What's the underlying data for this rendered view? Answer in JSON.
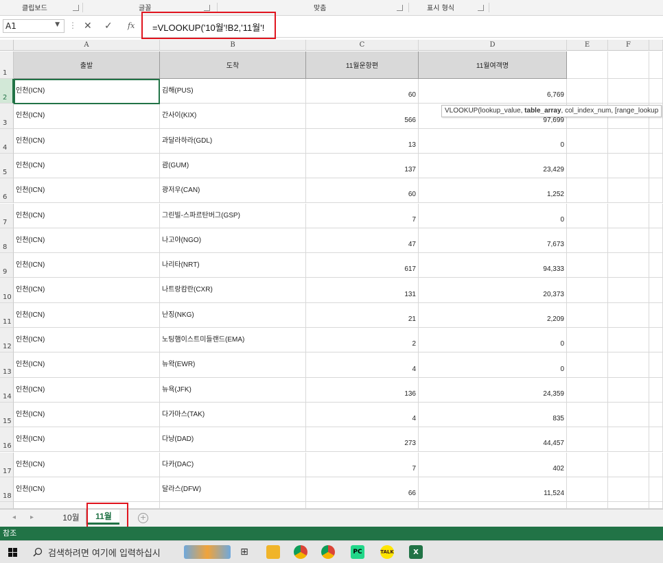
{
  "ribbon": {
    "groups": [
      "클립보드",
      "글꼴",
      "맞춤",
      "표시 형식"
    ]
  },
  "formula_bar": {
    "name_box": "A1",
    "formula": "=VLOOKUP('10월'!B2,'11월'!"
  },
  "tooltip": {
    "prefix": "VLOOKUP(lookup_value, ",
    "bold": "table_array",
    "suffix": ", col_index_num, [range_lookup"
  },
  "columns": [
    "A",
    "B",
    "C",
    "D",
    "E",
    "F"
  ],
  "headers": [
    "출발",
    "도착",
    "11월운항편",
    "11월여객명"
  ],
  "rows": [
    {
      "n": "1"
    },
    {
      "n": "2",
      "a": "인천(ICN)",
      "b": "김해(PUS)",
      "c": "60",
      "d": "6,769"
    },
    {
      "n": "3",
      "a": "인천(ICN)",
      "b": "간사이(KIX)",
      "c": "566",
      "d": "97,699"
    },
    {
      "n": "4",
      "a": "인천(ICN)",
      "b": "과달라하라(GDL)",
      "c": "13",
      "d": "0"
    },
    {
      "n": "5",
      "a": "인천(ICN)",
      "b": "괌(GUM)",
      "c": "137",
      "d": "23,429"
    },
    {
      "n": "6",
      "a": "인천(ICN)",
      "b": "광저우(CAN)",
      "c": "60",
      "d": "1,252"
    },
    {
      "n": "7",
      "a": "인천(ICN)",
      "b": "그린빌-스파르탄버그(GSP)",
      "c": "7",
      "d": "0"
    },
    {
      "n": "8",
      "a": "인천(ICN)",
      "b": "나고야(NGO)",
      "c": "47",
      "d": "7,673"
    },
    {
      "n": "9",
      "a": "인천(ICN)",
      "b": "나리타(NRT)",
      "c": "617",
      "d": "94,333"
    },
    {
      "n": "10",
      "a": "인천(ICN)",
      "b": "나트랑캄란(CXR)",
      "c": "131",
      "d": "20,373"
    },
    {
      "n": "11",
      "a": "인천(ICN)",
      "b": "난징(NKG)",
      "c": "21",
      "d": "2,209"
    },
    {
      "n": "12",
      "a": "인천(ICN)",
      "b": "노팅햄이스트미들랜드(EMA)",
      "c": "2",
      "d": "0"
    },
    {
      "n": "13",
      "a": "인천(ICN)",
      "b": "뉴왁(EWR)",
      "c": "4",
      "d": "0"
    },
    {
      "n": "14",
      "a": "인천(ICN)",
      "b": "뉴욕(JFK)",
      "c": "136",
      "d": "24,359"
    },
    {
      "n": "15",
      "a": "인천(ICN)",
      "b": "다가마스(TAK)",
      "c": "4",
      "d": "835"
    },
    {
      "n": "16",
      "a": "인천(ICN)",
      "b": "다낭(DAD)",
      "c": "273",
      "d": "44,457"
    },
    {
      "n": "17",
      "a": "인천(ICN)",
      "b": "다카(DAC)",
      "c": "7",
      "d": "402"
    },
    {
      "n": "18",
      "a": "인천(ICN)",
      "b": "달라스(DFW)",
      "c": "66",
      "d": "11,524"
    }
  ],
  "sheet_tabs": [
    "10월",
    "11월"
  ],
  "active_tab": "11월",
  "status_text": "참조",
  "taskbar": {
    "search_placeholder": "검색하려면 여기에 입력하십시",
    "icons": [
      "windows-start",
      "search",
      "cortana",
      "task-view",
      "file-explorer",
      "chrome",
      "chrome-alt",
      "pycharm",
      "kakaotalk",
      "excel"
    ]
  },
  "colors": {
    "excel_green": "#217346",
    "highlight_red": "#e0141e",
    "header_fill": "#d9d9d9"
  }
}
